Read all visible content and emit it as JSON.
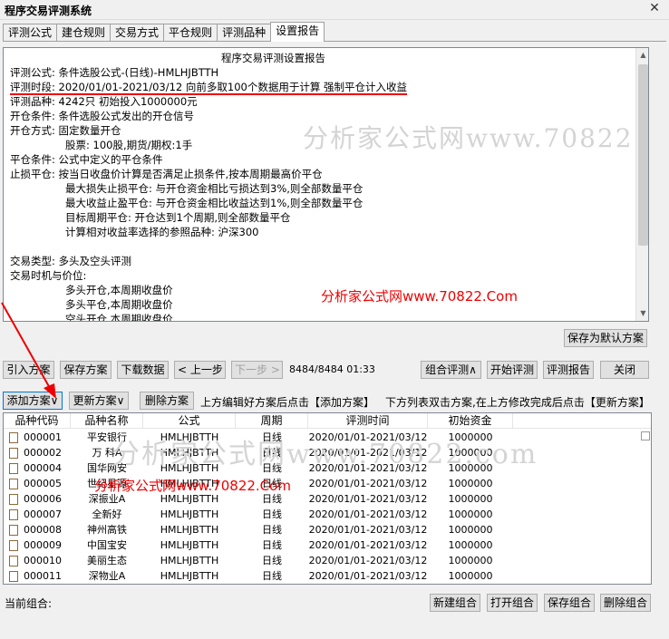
{
  "window": {
    "title": "程序交易评测系统",
    "close_icon": "✕"
  },
  "tabs": [
    "评测公式",
    "建仓规则",
    "交易方式",
    "平仓规则",
    "评测品种",
    "设置报告"
  ],
  "report": {
    "heading": "程序交易评测设置报告",
    "lines": [
      "评测公式: 条件选股公式-(日线)-HMLHJBTTH",
      "评测时段: 2020/01/01-2021/03/12 向前多取100个数据用于计算 强制平仓计入收益",
      "评测品种: 4242只 初始投入1000000元",
      "开仓条件: 条件选股公式发出的开仓信号",
      "开仓方式: 固定数量开仓",
      "股票: 100股,期货/期权:1手",
      "平仓条件: 公式中定义的平仓条件",
      "止损平仓: 按当日收盘价计算是否满足止损条件,按本周期最高价平仓",
      "最大损失止损平仓: 与开仓资金相比亏损达到3%,则全部数量平仓",
      "最大收益止盈平仓: 与开仓资金相比收益达到1%,则全部数量平仓",
      "目标周期平仓: 开仓达到1个周期,则全部数量平仓",
      "计算相对收益率选择的参照品种: 沪深300",
      "交易类型: 多头及空头评测",
      "交易时机与价位:",
      "多头开仓,本周期收盘价",
      "多头平仓,本周期收盘价",
      "空头开仓,本周期收盘价"
    ]
  },
  "watermarks": {
    "gray1": "分析家公式网www.70822.com",
    "red1": "分析家公式网www.70822.Com",
    "gray2": "分析家公式网www.70822.com",
    "red2": "分析家公式网www.70822.Com"
  },
  "buttons": {
    "save_default": "保存为默认方案",
    "import_plan": "引入方案",
    "save_plan": "保存方案",
    "download_data": "下载数据",
    "prev_step": "< 上一步",
    "next_step": "下一步 >",
    "combo_eval": "组合评测∧",
    "start_eval": "开始评测",
    "eval_report": "评测报告",
    "close": "关闭",
    "add_plan": "添加方案∨",
    "update_plan": "更新方案∨",
    "delete_plan": "删除方案",
    "new_combo": "新建组合",
    "open_combo": "打开组合",
    "save_combo": "保存组合",
    "delete_combo": "删除组合"
  },
  "status": {
    "progress": "8484/8484 01:33"
  },
  "hints": {
    "hint1": "上方编辑好方案后点击【添加方案】",
    "hint2": "下方列表双击方案,在上方修改完成后点击【更新方案】"
  },
  "table": {
    "columns": [
      "品种代码",
      "品种名称",
      "公式",
      "周期",
      "评测时间",
      "初始资金"
    ],
    "rows": [
      [
        "000001",
        "平安银行",
        "HMLHJBTTH",
        "日线",
        "2020/01/01-2021/03/12",
        "1000000"
      ],
      [
        "000002",
        "万 科A",
        "HMLHJBTTH",
        "日线",
        "2020/01/01-2021/03/12",
        "1000000"
      ],
      [
        "000004",
        "国华网安",
        "HMLHJBTTH",
        "日线",
        "2020/01/01-2021/03/12",
        "1000000"
      ],
      [
        "000005",
        "世纪星源",
        "HMLHJBTTH",
        "日线",
        "2020/01/01-2021/03/12",
        "1000000"
      ],
      [
        "000006",
        "深振业A",
        "HMLHJBTTH",
        "日线",
        "2020/01/01-2021/03/12",
        "1000000"
      ],
      [
        "000007",
        "全新好",
        "HMLHJBTTH",
        "日线",
        "2020/01/01-2021/03/12",
        "1000000"
      ],
      [
        "000008",
        "神州高铁",
        "HMLHJBTTH",
        "日线",
        "2020/01/01-2021/03/12",
        "1000000"
      ],
      [
        "000009",
        "中国宝安",
        "HMLHJBTTH",
        "日线",
        "2020/01/01-2021/03/12",
        "1000000"
      ],
      [
        "000010",
        "美丽生态",
        "HMLHJBTTH",
        "日线",
        "2020/01/01-2021/03/12",
        "1000000"
      ],
      [
        "000011",
        "深物业A",
        "HMLHJBTTH",
        "日线",
        "2020/01/01-2021/03/12",
        "1000000"
      ]
    ]
  },
  "footer": {
    "current_combo_label": "当前组合:"
  }
}
